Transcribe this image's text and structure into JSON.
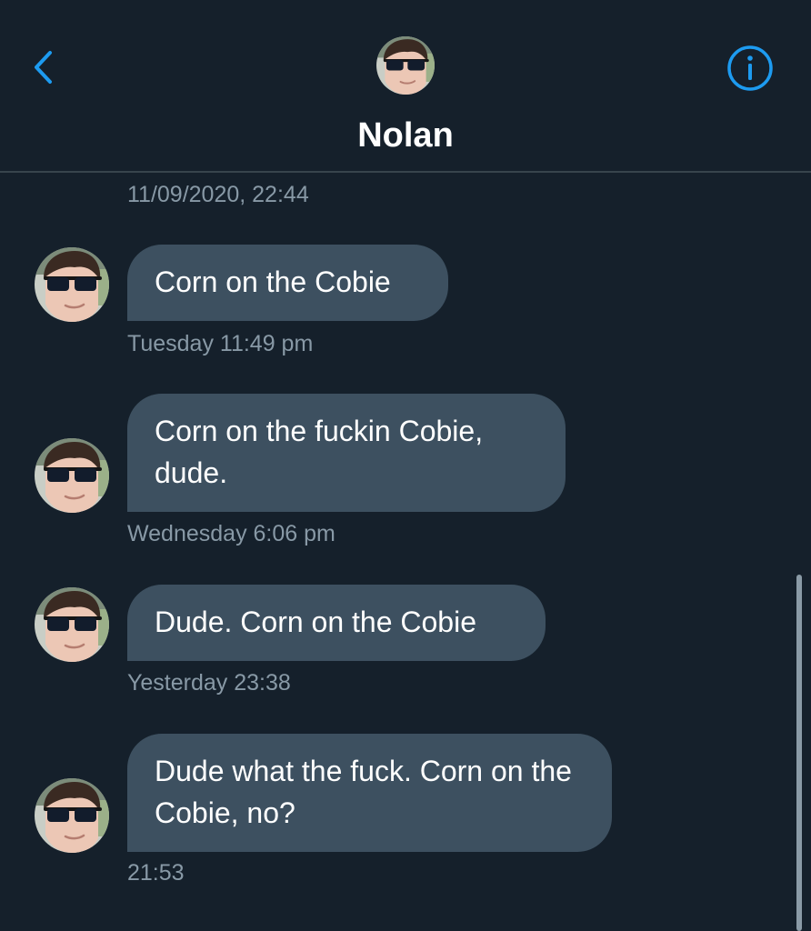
{
  "header": {
    "contact_name": "Nolan"
  },
  "conversation": {
    "top_timestamp": "11/09/2020, 22:44",
    "messages": [
      {
        "text": "Corn on the Cobie",
        "time": "Tuesday 11:49 pm"
      },
      {
        "text": "Corn on the fuckin Cobie, dude.",
        "time": "Wednesday 6:06 pm"
      },
      {
        "text": "Dude. Corn on the Cobie",
        "time": "Yesterday 23:38"
      },
      {
        "text": "Dude what the fuck. Corn on the Cobie, no?",
        "time": "21:53"
      }
    ]
  },
  "icons": {
    "back": "chevron-left-icon",
    "info": "info-circle-icon"
  },
  "colors": {
    "background": "#15202b",
    "bubble": "#3d5060",
    "accent": "#1d9bf0",
    "muted_text": "#8899a6",
    "divider": "#38444d"
  }
}
